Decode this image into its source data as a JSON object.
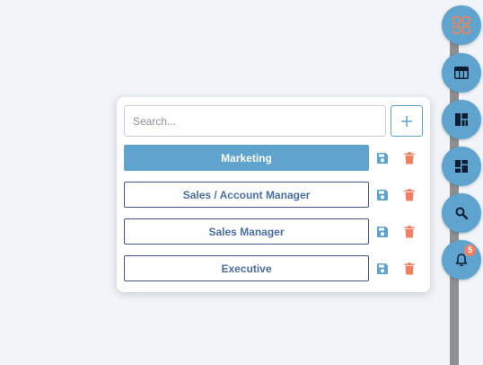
{
  "search": {
    "placeholder": "Search..."
  },
  "add_button": {
    "icon": "plus-icon"
  },
  "layouts": [
    {
      "label": "Marketing",
      "active": true
    },
    {
      "label": "Sales / Account Manager",
      "active": false
    },
    {
      "label": "Sales Manager",
      "active": false
    },
    {
      "label": "Executive",
      "active": false
    }
  ],
  "row_actions": {
    "save_icon": "floppy-disk-icon",
    "delete_icon": "trash-icon"
  },
  "rail": {
    "buttons": [
      "grid-icon",
      "table-layout-icon",
      "dashboard-layout-icon",
      "widgets-icon",
      "search-icon",
      "bell-icon"
    ],
    "notification_count": "5"
  },
  "colors": {
    "accent": "#5fa3cf",
    "button_border": "#41588e",
    "button_text": "#4a6fa5",
    "delete": "#f07f64",
    "badge": "#f07f64",
    "background": "#f1f5f9"
  }
}
